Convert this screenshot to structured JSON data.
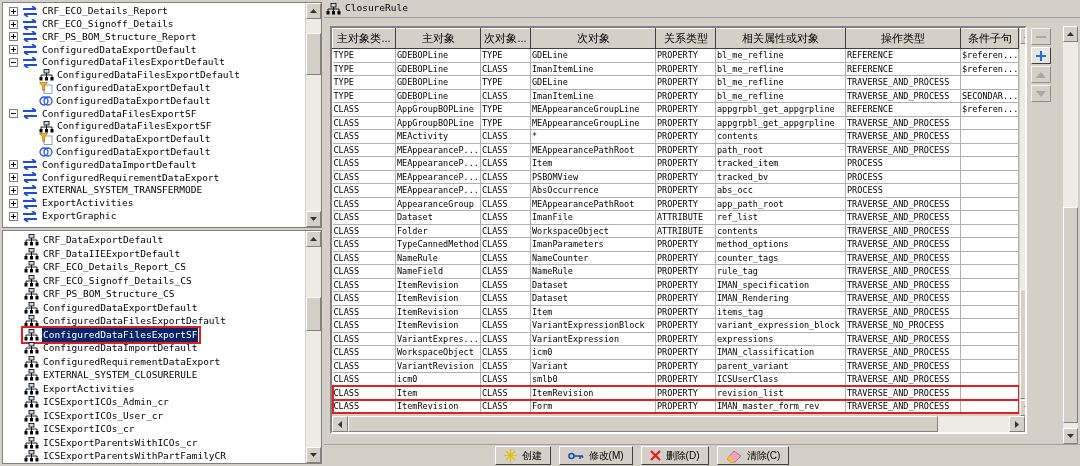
{
  "top_tree": {
    "items": [
      {
        "label": "CRF_ECO_Details_Report",
        "expanded": false
      },
      {
        "label": "CRF_ECO_Signoff_Details",
        "expanded": false
      },
      {
        "label": "CRF_PS_BOM_Structure_Report",
        "expanded": false
      },
      {
        "label": "ConfiguredDataExportDefault",
        "expanded": false
      },
      {
        "label": "ConfiguredDataFilesExportDefault",
        "expanded": true,
        "children": [
          {
            "kind": "closure",
            "label": "ConfiguredDataFilesExportDefault"
          },
          {
            "kind": "filter",
            "label": "ConfiguredDataExportDefault"
          },
          {
            "kind": "union",
            "label": "ConfiguredDataExportDefault"
          }
        ]
      },
      {
        "label": "ConfiguredDataFilesExportSF",
        "expanded": true,
        "children": [
          {
            "kind": "closure",
            "label": "ConfiguredDataFilesExportSF"
          },
          {
            "kind": "filter",
            "label": "ConfiguredDataExportDefault"
          },
          {
            "kind": "union",
            "label": "ConfiguredDataExportDefault"
          }
        ]
      },
      {
        "label": "ConfiguredDataImportDefault",
        "expanded": false
      },
      {
        "label": "ConfiguredRequirementDataExport",
        "expanded": false
      },
      {
        "label": "EXTERNAL_SYSTEM_TRANSFERMODE",
        "expanded": false
      },
      {
        "label": "ExportActivities",
        "expanded": false
      },
      {
        "label": "ExportGraphic",
        "expanded": false
      }
    ]
  },
  "bottom_tree": {
    "items": [
      {
        "label": "CRF_DataExportDefault",
        "selected": false
      },
      {
        "label": "CRF_DataIIEExportDefault",
        "selected": false
      },
      {
        "label": "CRF_ECO_Details_Report_CS",
        "selected": false
      },
      {
        "label": "CRF_ECO_Signoff_Details_CS",
        "selected": false
      },
      {
        "label": "CRF_PS_BOM_Structure_CS",
        "selected": false
      },
      {
        "label": "ConfiguredDataExportDefault",
        "selected": false
      },
      {
        "label": "ConfiguredDataFilesExportDefault",
        "selected": false
      },
      {
        "label": "ConfiguredDataFilesExportSF",
        "selected": true
      },
      {
        "label": "ConfiguredDataImportDefault",
        "selected": false
      },
      {
        "label": "ConfiguredRequirementDataExport",
        "selected": false
      },
      {
        "label": "EXTERNAL_SYSTEM_CLOSURERULE",
        "selected": false
      },
      {
        "label": "ExportActivities",
        "selected": false
      },
      {
        "label": "ICSExportICOs_Admin_cr",
        "selected": false
      },
      {
        "label": "ICSExportICOs_User_cr",
        "selected": false
      },
      {
        "label": "ICSExportICOs_cr",
        "selected": false
      },
      {
        "label": "ICSExportParentsWithICOs_cr",
        "selected": false
      },
      {
        "label": "ICSExportParentsWithPartFamilyCR",
        "selected": false
      }
    ]
  },
  "panel": {
    "title": "ClosureRule"
  },
  "table": {
    "columns": [
      "主对象类...",
      "主对象",
      "次对象...",
      "次对象",
      "关系类型",
      "相关属性或对象",
      "操作类型",
      "条件子句"
    ],
    "rows": [
      {
        "cells": [
          "TYPE",
          "GDEBOPLine",
          "TYPE",
          "GDELine",
          "PROPERTY",
          "bl_me_refline",
          "REFERENCE",
          "$referen..."
        ],
        "highlighted": false
      },
      {
        "cells": [
          "TYPE",
          "GDEBOPLine",
          "CLASS",
          "ImanItemLine",
          "PROPERTY",
          "bl_me_refline",
          "REFERENCE",
          "$referen..."
        ],
        "highlighted": false
      },
      {
        "cells": [
          "TYPE",
          "GDEBOPLine",
          "TYPE",
          "GDELine",
          "PROPERTY",
          "bl_me_refline",
          "TRAVERSE_AND_PROCESS",
          ""
        ],
        "highlighted": false
      },
      {
        "cells": [
          "TYPE",
          "GDEBOPLine",
          "CLASS",
          "ImanItemLine",
          "PROPERTY",
          "bl_me_refline",
          "TRAVERSE_AND_PROCESS",
          "SECONDAR..."
        ],
        "highlighted": false
      },
      {
        "cells": [
          "CLASS",
          "AppGroupBOPLine",
          "TYPE",
          "MEAppearanceGroupLine",
          "PROPERTY",
          "appgrpbl_get_appgrpline",
          "REFERENCE",
          "$referen..."
        ],
        "highlighted": false
      },
      {
        "cells": [
          "CLASS",
          "AppGroupBOPLine",
          "TYPE",
          "MEAppearanceGroupLine",
          "PROPERTY",
          "appgrpbl_get_appgrpline",
          "TRAVERSE_AND_PROCESS",
          ""
        ],
        "highlighted": false
      },
      {
        "cells": [
          "CLASS",
          "MEActivity",
          "CLASS",
          "*",
          "PROPERTY",
          "contents",
          "TRAVERSE_AND_PROCESS",
          ""
        ],
        "highlighted": false
      },
      {
        "cells": [
          "CLASS",
          "MEAppearanceP...",
          "CLASS",
          "MEAppearancePathRoot",
          "PROPERTY",
          "path_root",
          "TRAVERSE_AND_PROCESS",
          ""
        ],
        "highlighted": false
      },
      {
        "cells": [
          "CLASS",
          "MEAppearanceP...",
          "CLASS",
          "Item",
          "PROPERTY",
          "tracked_item",
          "PROCESS",
          ""
        ],
        "highlighted": false
      },
      {
        "cells": [
          "CLASS",
          "MEAppearanceP...",
          "CLASS",
          "PSBOMView",
          "PROPERTY",
          "tracked_bv",
          "PROCESS",
          ""
        ],
        "highlighted": false
      },
      {
        "cells": [
          "CLASS",
          "MEAppearanceP...",
          "CLASS",
          "AbsOccurrence",
          "PROPERTY",
          "abs_occ",
          "PROCESS",
          ""
        ],
        "highlighted": false
      },
      {
        "cells": [
          "CLASS",
          "AppearanceGroup",
          "CLASS",
          "MEAppearancePathRoot",
          "PROPERTY",
          "app_path_root",
          "TRAVERSE_AND_PROCESS",
          ""
        ],
        "highlighted": false
      },
      {
        "cells": [
          "CLASS",
          "Dataset",
          "CLASS",
          "ImanFile",
          "ATTRIBUTE",
          "ref_list",
          "TRAVERSE_AND_PROCESS",
          ""
        ],
        "highlighted": false
      },
      {
        "cells": [
          "CLASS",
          "Folder",
          "CLASS",
          "WorkspaceObject",
          "ATTRIBUTE",
          "contents",
          "TRAVERSE_AND_PROCESS",
          ""
        ],
        "highlighted": false
      },
      {
        "cells": [
          "CLASS",
          "TypeCannedMethod",
          "CLASS",
          "ImanParameters",
          "PROPERTY",
          "method_options",
          "TRAVERSE_AND_PROCESS",
          ""
        ],
        "highlighted": false
      },
      {
        "cells": [
          "CLASS",
          "NameRule",
          "CLASS",
          "NameCounter",
          "PROPERTY",
          "counter_tags",
          "TRAVERSE_AND_PROCESS",
          ""
        ],
        "highlighted": false
      },
      {
        "cells": [
          "CLASS",
          "NameField",
          "CLASS",
          "NameRule",
          "PROPERTY",
          "rule_tag",
          "TRAVERSE_AND_PROCESS",
          ""
        ],
        "highlighted": false
      },
      {
        "cells": [
          "CLASS",
          "ItemRevision",
          "CLASS",
          "Dataset",
          "PROPERTY",
          "IMAN_specification",
          "TRAVERSE_AND_PROCESS",
          ""
        ],
        "highlighted": false
      },
      {
        "cells": [
          "CLASS",
          "ItemRevision",
          "CLASS",
          "Dataset",
          "PROPERTY",
          "IMAN_Rendering",
          "TRAVERSE_AND_PROCESS",
          ""
        ],
        "highlighted": false
      },
      {
        "cells": [
          "CLASS",
          "ItemRevision",
          "CLASS",
          "Item",
          "PROPERTY",
          "items_tag",
          "TRAVERSE_AND_PROCESS",
          ""
        ],
        "highlighted": false
      },
      {
        "cells": [
          "CLASS",
          "ItemRevision",
          "CLASS",
          "VariantExpressionBlock",
          "PROPERTY",
          "variant_expression_block",
          "TRAVERSE_NO_PROCESS",
          ""
        ],
        "highlighted": false
      },
      {
        "cells": [
          "CLASS",
          "VariantExpres...",
          "CLASS",
          "VariantExpression",
          "PROPERTY",
          "expressions",
          "TRAVERSE_AND_PROCESS",
          ""
        ],
        "highlighted": false
      },
      {
        "cells": [
          "CLASS",
          "WorkspaceObject",
          "CLASS",
          "icm0",
          "PROPERTY",
          "IMAN_classification",
          "TRAVERSE_AND_PROCESS",
          ""
        ],
        "highlighted": false
      },
      {
        "cells": [
          "CLASS",
          "VariantRevision",
          "CLASS",
          "Variant",
          "PROPERTY",
          "parent_variant",
          "TRAVERSE_AND_PROCESS",
          ""
        ],
        "highlighted": false
      },
      {
        "cells": [
          "CLASS",
          "icm0",
          "CLASS",
          "smlb0",
          "PROPERTY",
          "ICSUserClass",
          "TRAVERSE_AND_PROCESS",
          ""
        ],
        "highlighted": false
      },
      {
        "cells": [
          "CLASS",
          "Item",
          "CLASS",
          "ItemRevision",
          "PROPERTY",
          "revision_list",
          "TRAVERSE_AND_PROCESS",
          ""
        ],
        "highlighted": true
      },
      {
        "cells": [
          "CLASS",
          "ItemRevision",
          "CLASS",
          "Form",
          "PROPERTY",
          "IMAN_master_form_rev",
          "TRAVERSE_AND_PROCESS",
          ""
        ],
        "highlighted": true
      }
    ]
  },
  "side_buttons": [
    {
      "kind": "remove",
      "disabled": true
    },
    {
      "kind": "add",
      "disabled": false
    },
    {
      "kind": "up",
      "disabled": true
    },
    {
      "kind": "down",
      "disabled": true
    }
  ],
  "buttons": [
    {
      "kind": "create",
      "label": "创建"
    },
    {
      "kind": "modify",
      "label": "修改(M)"
    },
    {
      "kind": "delete",
      "label": "删除(D)"
    },
    {
      "kind": "clear",
      "label": "清除(C)"
    }
  ]
}
